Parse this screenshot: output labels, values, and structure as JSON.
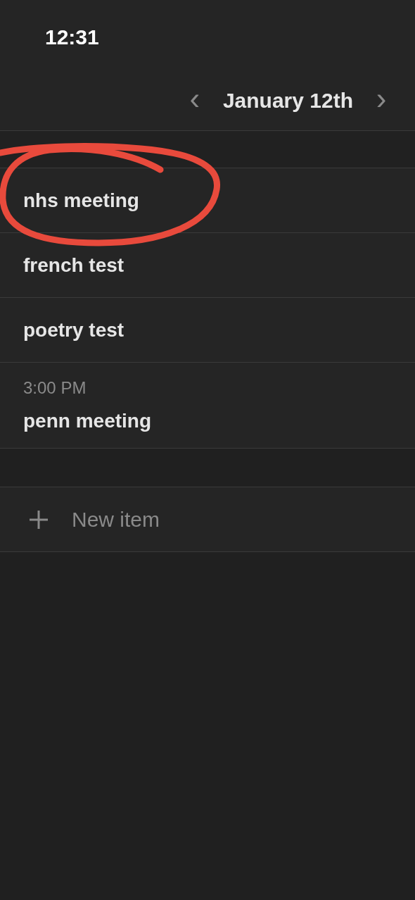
{
  "status_bar": {
    "time": "12:31"
  },
  "header": {
    "prev": "‹",
    "date": "January 12th",
    "next": "›"
  },
  "items": [
    {
      "title": "nhs meeting",
      "circled": true
    },
    {
      "title": "french test",
      "circled": false
    },
    {
      "title": "poetry test",
      "circled": false
    },
    {
      "time": "3:00 PM",
      "title": "penn meeting",
      "circled": false
    }
  ],
  "new_item": {
    "label": "New item"
  }
}
